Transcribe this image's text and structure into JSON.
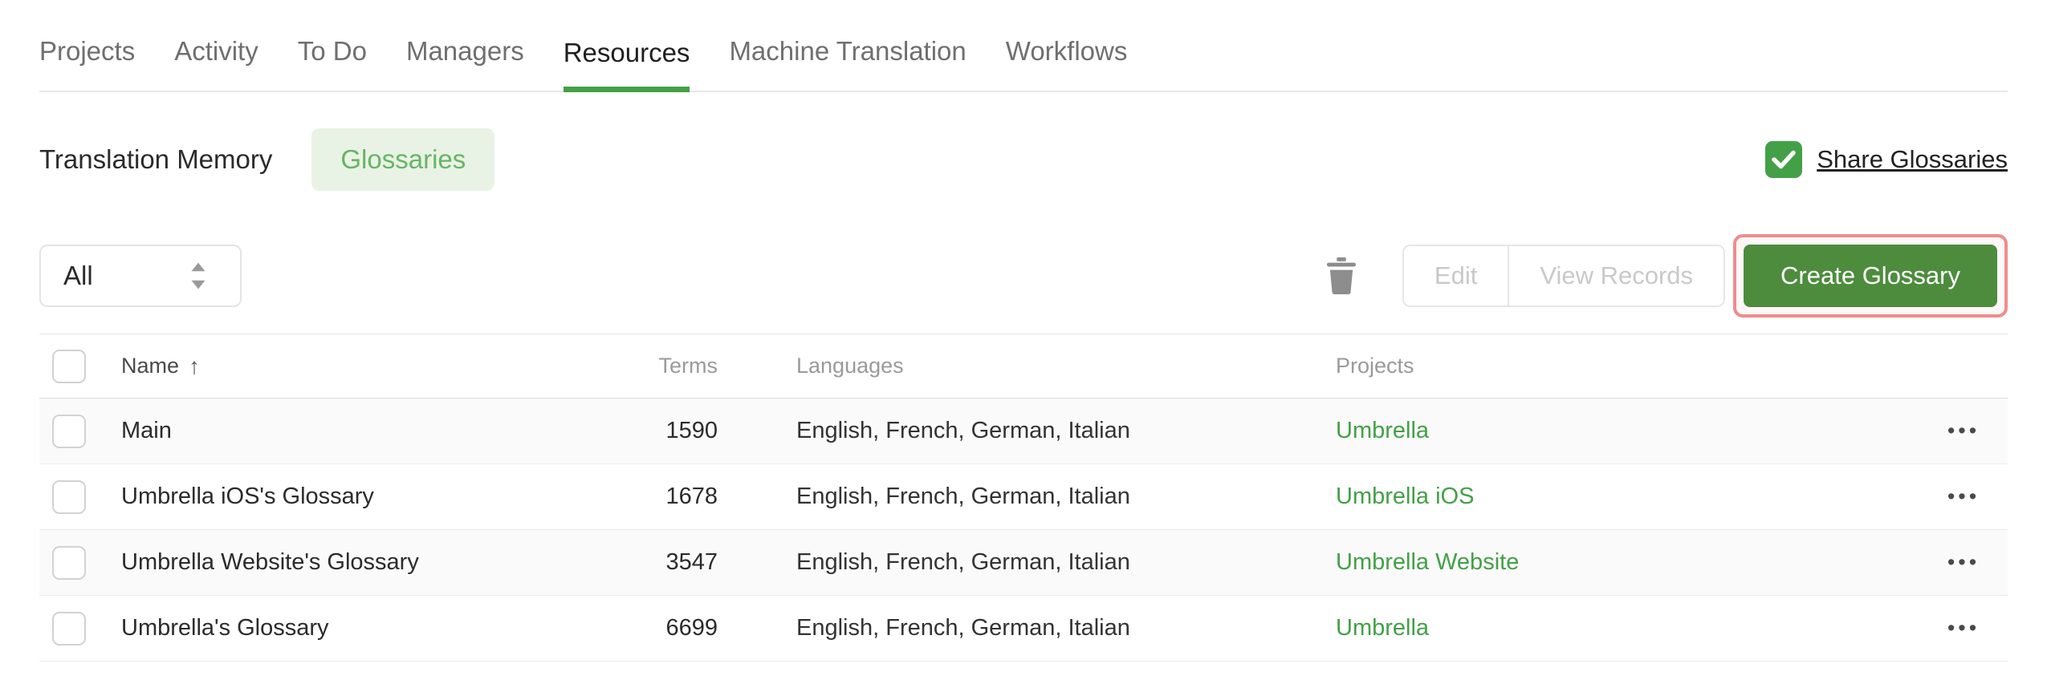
{
  "nav": {
    "items": [
      {
        "label": "Projects",
        "active": false
      },
      {
        "label": "Activity",
        "active": false
      },
      {
        "label": "To Do",
        "active": false
      },
      {
        "label": "Managers",
        "active": false
      },
      {
        "label": "Resources",
        "active": true
      },
      {
        "label": "Machine Translation",
        "active": false
      },
      {
        "label": "Workflows",
        "active": false
      }
    ]
  },
  "subtabs": {
    "translation_memory": "Translation Memory",
    "glossaries": "Glossaries"
  },
  "share": {
    "label": "Share Glossaries",
    "checked": true
  },
  "toolbar": {
    "filter_value": "All",
    "edit_label": "Edit",
    "view_records_label": "View Records",
    "create_label": "Create Glossary"
  },
  "table": {
    "headers": {
      "name": "Name",
      "terms": "Terms",
      "languages": "Languages",
      "projects": "Projects"
    },
    "sort": {
      "column": "Name",
      "direction": "ascending"
    },
    "rows": [
      {
        "name": "Main",
        "terms": 1590,
        "languages": "English, French, German, Italian",
        "project": "Umbrella",
        "checked": false
      },
      {
        "name": "Umbrella iOS's Glossary",
        "terms": 1678,
        "languages": "English, French, German, Italian",
        "project": "Umbrella iOS",
        "checked": false
      },
      {
        "name": "Umbrella Website's Glossary",
        "terms": 3547,
        "languages": "English, French, German, Italian",
        "project": "Umbrella Website",
        "checked": false
      },
      {
        "name": "Umbrella's Glossary",
        "terms": 6699,
        "languages": "English, French, German, Italian",
        "project": "Umbrella",
        "checked": false
      }
    ]
  },
  "icons": {
    "sort_ascending": "↑",
    "row_menu": "•••"
  },
  "colors": {
    "accent_green": "#43a047",
    "button_green": "#4d8c3d",
    "pill_background": "#e9f3e5",
    "pill_text": "#68b467",
    "link_green": "#43a047",
    "highlight_red": "#ef8c8c",
    "disabled_text": "#c9c9c9",
    "header_gray": "#9a9a9a"
  }
}
